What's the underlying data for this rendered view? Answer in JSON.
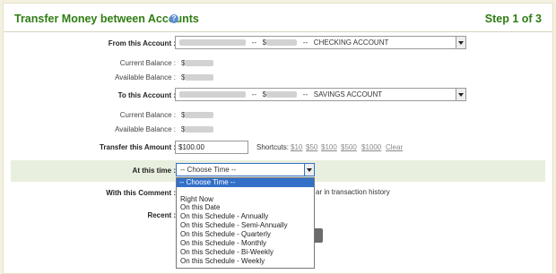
{
  "header": {
    "title": "Transfer Money between Accounts",
    "help_glyph": "?",
    "step": "Step 1 of 3"
  },
  "from": {
    "label": "From this Account :",
    "dash1": "--",
    "currency": "$",
    "dash2": "--",
    "account_type": "CHECKING ACCOUNT",
    "current_balance_label": "Current Balance :",
    "current_balance_prefix": "$",
    "available_balance_label": "Available Balance :",
    "available_balance_prefix": "$"
  },
  "to": {
    "label": "To this Account :",
    "dash1": "--",
    "currency": "$",
    "dash2": "--",
    "account_type": "SAVINGS ACCOUNT",
    "current_balance_label": "Current Balance :",
    "current_balance_prefix": "$",
    "available_balance_label": "Available Balance :",
    "available_balance_prefix": "$"
  },
  "amount": {
    "label": "Transfer this Amount :",
    "value": "$100.00",
    "shortcuts_label": "Shortcuts:",
    "shortcuts": [
      "$10",
      "$50",
      "$100",
      "$500",
      "$1000",
      "Clear"
    ]
  },
  "time": {
    "label": "At this time :",
    "selected": "-- Choose Time --",
    "options": [
      "-- Choose Time --",
      "",
      "Right Now",
      "On this Date",
      "On this Schedule - Annually",
      "On this Schedule - Semi-Annually",
      "On this Schedule - Quarterly",
      "On this Schedule - Monthly",
      "On this Schedule - Bi-Weekly",
      "On this Schedule - Weekly"
    ]
  },
  "comment": {
    "label": "With this Comment :",
    "hint_tail": "ar in transaction history"
  },
  "recent": {
    "label": "Recent :"
  },
  "colors": {
    "accent_green": "#2e7d13",
    "highlight": "#e8efde",
    "selected_option": "#3370c8"
  }
}
